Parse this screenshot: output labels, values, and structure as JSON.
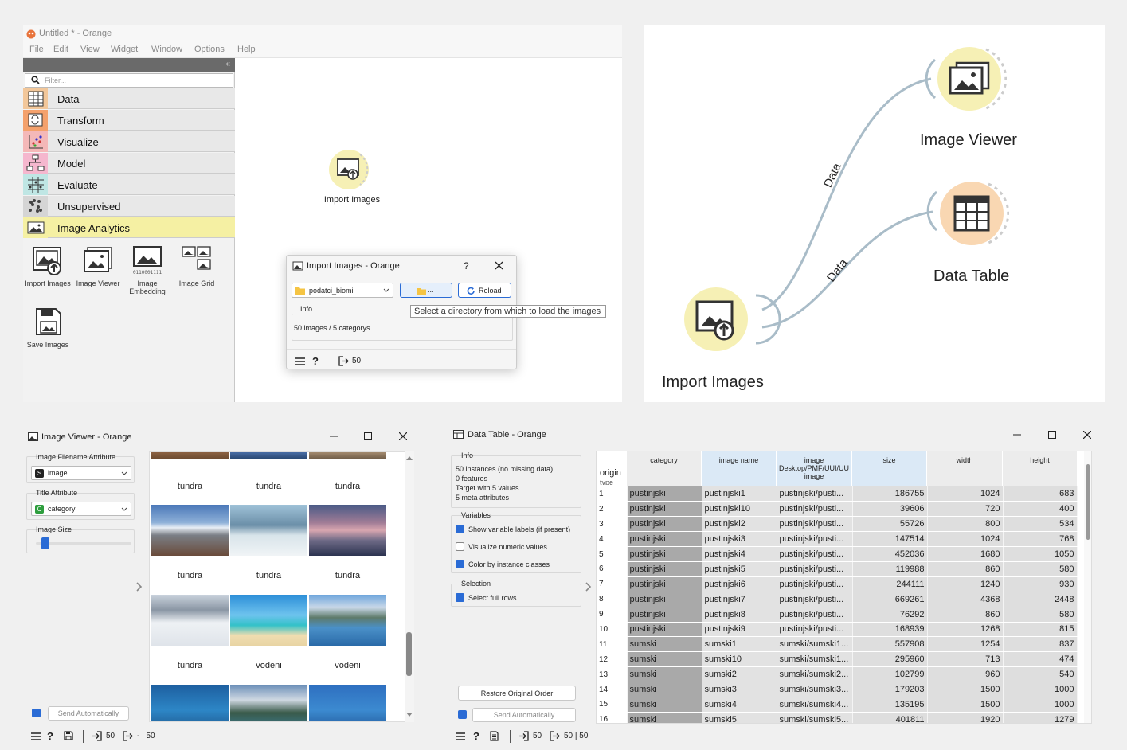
{
  "main_window": {
    "title": "Untitled * - Orange",
    "menu": [
      "File",
      "Edit",
      "View",
      "Widget",
      "Window",
      "Options",
      "Help"
    ],
    "collapse_glyph": "«",
    "filter_placeholder": "Filter...",
    "categories": [
      {
        "label": "Data",
        "color": "#f2c79a",
        "icon": "table-icon"
      },
      {
        "label": "Transform",
        "color": "#f4a16c",
        "icon": "transform-icon"
      },
      {
        "label": "Visualize",
        "color": "#f4b8b8",
        "icon": "scatter-icon"
      },
      {
        "label": "Model",
        "color": "#f5b7ce",
        "icon": "tree-icon"
      },
      {
        "label": "Evaluate",
        "color": "#bfe6e4",
        "icon": "evaluate-icon"
      },
      {
        "label": "Unsupervised",
        "color": "#d5d5d5",
        "icon": "clusters-icon"
      },
      {
        "label": "Image Analytics",
        "color": "#f5f0a3",
        "icon": "image-icon"
      }
    ],
    "widgets": [
      {
        "label": "Import Images"
      },
      {
        "label": "Image Viewer"
      },
      {
        "label": "Image Embedding"
      },
      {
        "label": "Image Grid"
      },
      {
        "label": "Save Images"
      }
    ],
    "canvas_node_label": "Import Images"
  },
  "import_dialog": {
    "title": "Import Images - Orange",
    "help": "?",
    "directory": "podatci_biomi",
    "browse_label": "...",
    "reload_label": "Reload",
    "tooltip": "Select a directory from which to load the images",
    "info_title": "Info",
    "info_text": "50 images / 5 categorys",
    "output_count": "50"
  },
  "workflow": {
    "nodes": [
      {
        "label": "Image Viewer"
      },
      {
        "label": "Data Table"
      },
      {
        "label": "Import Images"
      }
    ],
    "link_labels": [
      "Data",
      "Data"
    ]
  },
  "image_viewer": {
    "title": "Image Viewer - Orange",
    "filename_attr_label": "Image Filename Attribute",
    "filename_attr_value": "image",
    "filename_attr_badge": "S",
    "title_attr_label": "Title Attribute",
    "title_attr_value": "category",
    "title_attr_badge": "C",
    "image_size_label": "Image Size",
    "image_size_level": 0.1,
    "send_auto_label": "Send Automatically",
    "status_in": "50",
    "status_out": "- | 50",
    "captions": [
      "tundra",
      "tundra",
      "tundra",
      "tundra",
      "tundra",
      "tundra",
      "tundra",
      "vodeni",
      "vodeni"
    ]
  },
  "data_table": {
    "title": "Data Table - Orange",
    "info_title": "Info",
    "info_lines": [
      "50 instances (no missing data)",
      "0  features",
      "Target with 5 values",
      "5 meta attributes"
    ],
    "variables_title": "Variables",
    "options": [
      {
        "label": "Show variable labels (if present)",
        "checked": true
      },
      {
        "label": "Visualize numeric values",
        "checked": false
      },
      {
        "label": "Color by instance classes",
        "checked": true
      }
    ],
    "selection_title": "Selection",
    "select_full_rows_label": "Select full rows",
    "select_full_rows_checked": true,
    "restore_label": "Restore Original Order",
    "send_auto_label": "Send Automatically",
    "status_in": "50",
    "status_out": "50 | 50",
    "corner_label": "origin",
    "corner_sub": "type",
    "columns": [
      "category",
      "image name",
      "image",
      "size",
      "width",
      "height"
    ],
    "image_col_sub1": "Desktop/PMF/UUI/UU",
    "image_col_sub2": "image",
    "rows": [
      [
        "1",
        "pustinjski",
        "pustinjski1",
        "pustinjski/pusti...",
        "186755",
        "1024",
        "683"
      ],
      [
        "2",
        "pustinjski",
        "pustinjski10",
        "pustinjski/pusti...",
        "39606",
        "720",
        "400"
      ],
      [
        "3",
        "pustinjski",
        "pustinjski2",
        "pustinjski/pusti...",
        "55726",
        "800",
        "534"
      ],
      [
        "4",
        "pustinjski",
        "pustinjski3",
        "pustinjski/pusti...",
        "147514",
        "1024",
        "768"
      ],
      [
        "5",
        "pustinjski",
        "pustinjski4",
        "pustinjski/pusti...",
        "452036",
        "1680",
        "1050"
      ],
      [
        "6",
        "pustinjski",
        "pustinjski5",
        "pustinjski/pusti...",
        "119988",
        "860",
        "580"
      ],
      [
        "7",
        "pustinjski",
        "pustinjski6",
        "pustinjski/pusti...",
        "244111",
        "1240",
        "930"
      ],
      [
        "8",
        "pustinjski",
        "pustinjski7",
        "pustinjski/pusti...",
        "669261",
        "4368",
        "2448"
      ],
      [
        "9",
        "pustinjski",
        "pustinjski8",
        "pustinjski/pusti...",
        "76292",
        "860",
        "580"
      ],
      [
        "10",
        "pustinjski",
        "pustinjski9",
        "pustinjski/pusti...",
        "168939",
        "1268",
        "815"
      ],
      [
        "11",
        "sumski",
        "sumski1",
        "sumski/sumski1...",
        "557908",
        "1254",
        "837"
      ],
      [
        "12",
        "sumski",
        "sumski10",
        "sumski/sumski1...",
        "295960",
        "713",
        "474"
      ],
      [
        "13",
        "sumski",
        "sumski2",
        "sumski/sumski2...",
        "102799",
        "960",
        "540"
      ],
      [
        "14",
        "sumski",
        "sumski3",
        "sumski/sumski3...",
        "179203",
        "1500",
        "1000"
      ],
      [
        "15",
        "sumski",
        "sumski4",
        "sumski/sumski4...",
        "135195",
        "1500",
        "1000"
      ],
      [
        "16",
        "sumski",
        "sumski5",
        "sumski/sumski5...",
        "401811",
        "1920",
        "1279"
      ]
    ]
  }
}
